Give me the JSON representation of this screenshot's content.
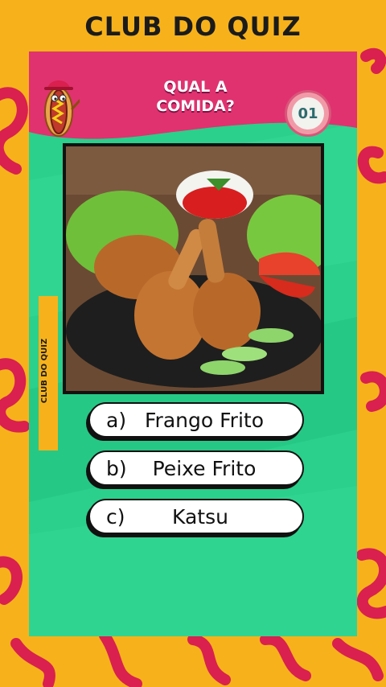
{
  "brand": {
    "title": "CLUB DO QUIZ"
  },
  "header": {
    "question_line1": "QUAL A",
    "question_line2": "COMIDA?",
    "counter": "01"
  },
  "side_label": "CLUB DO QUIZ",
  "answers": [
    {
      "letter": "a)",
      "text": "Frango Frito"
    },
    {
      "letter": "b)",
      "text": "Peixe Frito"
    },
    {
      "letter": "c)",
      "text": "Katsu"
    }
  ],
  "colors": {
    "background": "#f7b21b",
    "card": "#2ad08b",
    "header": "#e0326f",
    "accent": "#d9204f"
  }
}
